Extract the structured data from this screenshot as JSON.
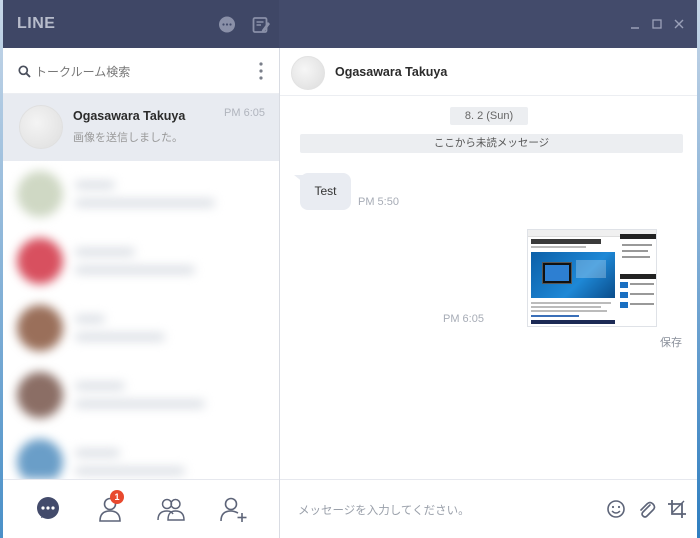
{
  "app": {
    "title": "LINE"
  },
  "search": {
    "placeholder": "トークルーム検索"
  },
  "active_chat": {
    "name": "Ogasawara Takuya",
    "time": "PM 6:05",
    "preview": "画像を送信しました。"
  },
  "nav": {
    "friends_badge": "1"
  },
  "conversation": {
    "contact_name": "Ogasawara Takuya",
    "date_label": "8. 2 (Sun)",
    "unread_divider": "ここから未読メッセージ",
    "messages": [
      {
        "text": "Test",
        "time": "PM 5:50"
      },
      {
        "type": "image",
        "time": "PM 6:05",
        "save_label": "保存"
      }
    ]
  },
  "composer": {
    "placeholder": "メッセージを入力してください。"
  },
  "colors": {
    "titlebar": "#434b6b",
    "active_row": "#e8ebf1",
    "badge": "#e8492e",
    "bubble": "#e9ecf2"
  },
  "icons": {
    "titlebar": [
      "chat-bubble-icon",
      "compose-icon",
      "minimize-icon",
      "maximize-icon",
      "close-icon"
    ],
    "nav": [
      "chats-icon",
      "friends-icon",
      "groups-icon",
      "add-friend-icon"
    ],
    "composer": [
      "emoji-icon",
      "attach-icon",
      "crop-icon"
    ]
  }
}
